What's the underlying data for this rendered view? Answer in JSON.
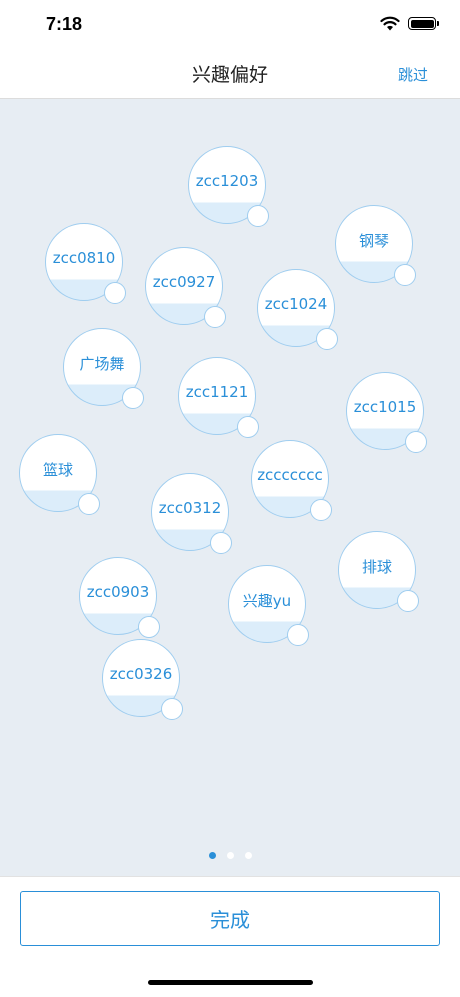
{
  "status_bar": {
    "time": "7:18"
  },
  "nav": {
    "title": "兴趣偏好",
    "skip_label": "跳过"
  },
  "bubbles": [
    "zcc1203",
    "钢琴",
    "zcc0810",
    "zcc0927",
    "zcc1024",
    "广场舞",
    "zcc1121",
    "zcc1015",
    "篮球",
    "zccccccc",
    "zcc0312",
    "排球",
    "zcc0903",
    "兴趣yu",
    "zcc0326"
  ],
  "pager": {
    "page_count": 3,
    "current_page": 1
  },
  "footer": {
    "done_label": "完成"
  },
  "colors": {
    "accent": "#2a8fd8",
    "bubble_border": "#9fcdef",
    "area_bg": "#e7edf3"
  }
}
